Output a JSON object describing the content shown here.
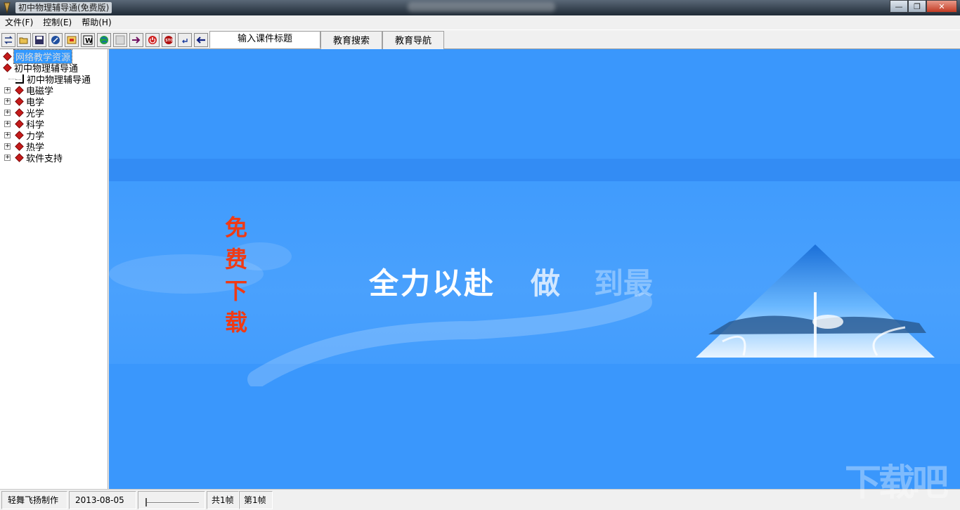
{
  "window": {
    "title": "初中物理辅导通(免费版)"
  },
  "menu": [
    {
      "label": "文件(F)"
    },
    {
      "label": "控制(E)"
    },
    {
      "label": "帮助(H)"
    }
  ],
  "toolbar": {
    "tabs": [
      {
        "label": "输入课件标题"
      },
      {
        "label": "教育搜索"
      },
      {
        "label": "教育导航"
      }
    ]
  },
  "tree": {
    "root_selected": "网络教学资源",
    "root": "初中物理辅导通",
    "child": "初中物理辅导通",
    "items": [
      {
        "label": "电磁学"
      },
      {
        "label": "电学"
      },
      {
        "label": "光学"
      },
      {
        "label": "科学"
      },
      {
        "label": "力学"
      },
      {
        "label": "热学"
      },
      {
        "label": "软件支持"
      }
    ]
  },
  "banner": {
    "vertical_text": [
      "免",
      "费",
      "下",
      "载"
    ],
    "slogan": "全力以赴",
    "slogan_faded": "做",
    "slogan_ghost": "到最"
  },
  "status": {
    "author": "轻舞飞扬制作",
    "date": "2013-08-05",
    "total_frames": "共1帧",
    "current_frame": "第1帧"
  },
  "watermark": "下载吧",
  "colors": {
    "main_bg": "#3a97fc",
    "accent_text": "#f03a14"
  }
}
